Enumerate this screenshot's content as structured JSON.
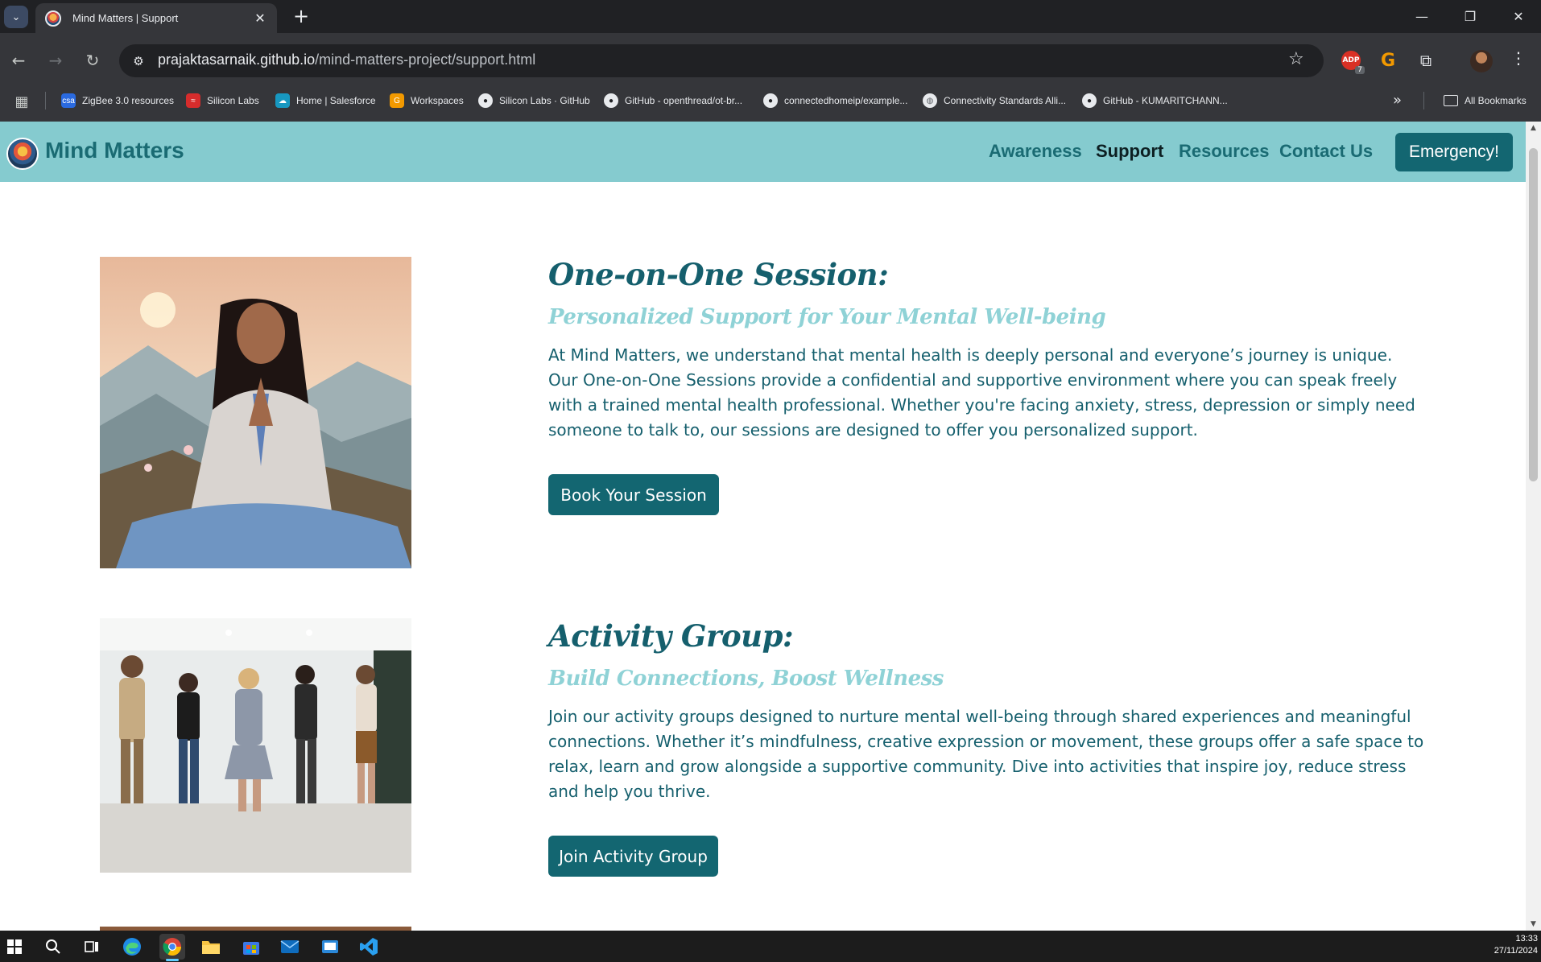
{
  "browser": {
    "tab_title": "Mind Matters | Support",
    "url_host": "prajaktasarnaik.github.io",
    "url_path": "/mind-matters-project/support.html",
    "adp_badge": "ADP",
    "adp_count": "7",
    "bookmarks": [
      {
        "label": "ZigBee 3.0 resources",
        "icon": "csa-icon",
        "color": "#2a6ae0"
      },
      {
        "label": "Silicon Labs",
        "icon": "silabs-icon",
        "color": "#d62c2c"
      },
      {
        "label": "Home | Salesforce",
        "icon": "salesforce-cloud-icon",
        "color": "#1798c1"
      },
      {
        "label": "Workspaces",
        "icon": "workspaces-icon",
        "color": "#f29900"
      },
      {
        "label": "Silicon Labs · GitHub",
        "icon": "github-icon",
        "color": "#202124"
      },
      {
        "label": "GitHub - openthread/ot-br...",
        "icon": "github-icon",
        "color": "#202124"
      },
      {
        "label": "connectedhomeip/example...",
        "icon": "github-icon",
        "color": "#202124"
      },
      {
        "label": "Connectivity Standards Alli...",
        "icon": "globe-icon",
        "color": "#5f6368"
      },
      {
        "label": "GitHub - KUMARITCHANN...",
        "icon": "github-icon",
        "color": "#202124"
      }
    ],
    "all_bookmarks": "All Bookmarks"
  },
  "site": {
    "name": "Mind Matters",
    "nav": [
      {
        "label": "Awareness",
        "active": false
      },
      {
        "label": "Support",
        "active": true
      },
      {
        "label": "Resources",
        "active": false
      },
      {
        "label": "Contact Us",
        "active": false
      }
    ],
    "emergency_label": "Emergency!"
  },
  "sections": [
    {
      "title": "One-on-One Session:",
      "subtitle": "Personalized Support for Your Mental Well-being",
      "body": "At Mind Matters, we understand that mental health is deeply personal and everyone’s journey is unique. Our One-on-One Sessions provide a confidential and supportive environment where you can speak freely with a trained mental health professional. Whether you're facing anxiety, stress, depression or simply need someone to talk to, our sessions are designed to offer you personalized support.",
      "button": "Book Your Session",
      "image": "meditating-woman-photo"
    },
    {
      "title": "Activity Group:",
      "subtitle": "Build Connections, Boost Wellness",
      "body": "Join our activity groups designed to nurture mental well-being through shared experiences and meaningful connections. Whether it’s mindfulness, creative expression or movement, these groups offer a safe space to relax, learn and grow alongside a supportive community. Dive into activities that inspire joy, reduce stress and help you thrive.",
      "button": "Join Activity Group",
      "image": "dancing-group-photo"
    }
  ],
  "colors": {
    "header_bg": "#85cbcf",
    "brand_teal": "#136671",
    "title_teal": "#155f6d",
    "subtitle_teal": "#8fd2d6"
  },
  "taskbar": {
    "time": "13:33",
    "date": "27/11/2024"
  }
}
